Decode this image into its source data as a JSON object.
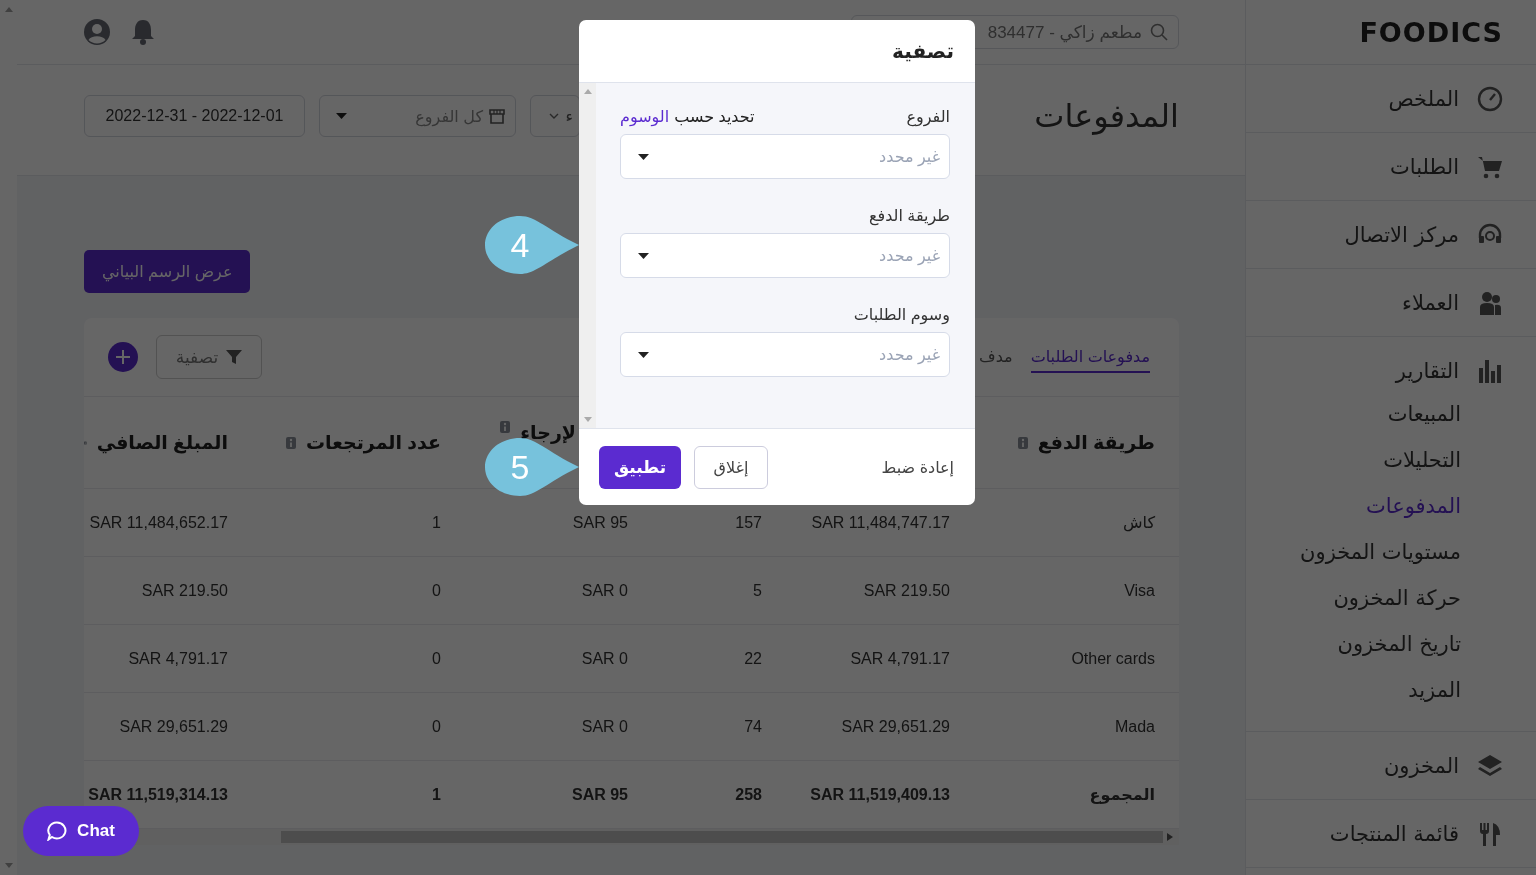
{
  "topbar": {
    "search_value": "مطعم زاكي - 834477"
  },
  "page": {
    "title": "المدفوعات",
    "filters": [
      {
        "kind": "dropdown",
        "text": "ء"
      },
      {
        "kind": "branches",
        "text": "كل الفروع"
      },
      {
        "kind": "date",
        "text": "2022-12-31 - 2022-12-01"
      }
    ],
    "chart_button": "عرض الرسم البياني"
  },
  "table": {
    "tabs": [
      {
        "label": "مدفوعات الطلبات",
        "selected": true
      },
      {
        "label": "مدف",
        "selected": false
      }
    ],
    "filter_button": "تصفية",
    "columns": [
      {
        "label": "طريقة الدفع"
      },
      {},
      {},
      {
        "label": "لإرجاء"
      },
      {
        "label": "عدد المرتجعات"
      },
      {
        "label": "المبلغ الصافي"
      }
    ],
    "rows": [
      {
        "cells": [
          "كاش",
          "SAR 11,484,747.17",
          "157",
          "SAR 95",
          "1",
          "SAR 11,484,652.17"
        ]
      },
      {
        "cells": [
          "Visa",
          "SAR 219.50",
          "5",
          "SAR 0",
          "0",
          "SAR 219.50"
        ]
      },
      {
        "cells": [
          "Other cards",
          "SAR 4,791.17",
          "22",
          "SAR 0",
          "0",
          "SAR 4,791.17"
        ]
      },
      {
        "cells": [
          "Mada",
          "SAR 29,651.29",
          "74",
          "SAR 0",
          "0",
          "SAR 29,651.29"
        ]
      }
    ],
    "total_row": [
      "المجموع",
      "SAR 11,519,409.13",
      "258",
      "SAR 95",
      "1",
      "SAR 11,519,314.13"
    ]
  },
  "sidebar": {
    "brand": "FOODICS",
    "items": [
      {
        "label": "الملخص"
      },
      {
        "label": "الطلبات"
      },
      {
        "label": "مركز الاتصال"
      },
      {
        "label": "العملاء"
      },
      {
        "label": "التقارير",
        "expanded": true,
        "children": [
          {
            "label": "المبيعات",
            "selected": false
          },
          {
            "label": "التحليلات",
            "selected": false
          },
          {
            "label": "المدفوعات",
            "selected": true
          },
          {
            "label": "مستويات المخزون",
            "selected": false
          },
          {
            "label": "حركة المخزون",
            "selected": false
          },
          {
            "label": "تاريخ المخزون",
            "selected": false
          },
          {
            "label": "المزيد",
            "selected": false
          }
        ]
      },
      {
        "label": "المخزون"
      },
      {
        "label": "قائمة المنتجات"
      }
    ]
  },
  "modal": {
    "title": "تصفية",
    "fields": [
      {
        "label": "الفروع",
        "aside_text": "تحديد حسب",
        "aside_link": "الوسوم",
        "placeholder": "غير محدد"
      },
      {
        "label": "طريقة الدفع",
        "placeholder": "غير محدد"
      },
      {
        "label": "وسوم الطلبات",
        "placeholder": "غير محدد"
      }
    ],
    "reset": "إعادة ضبط",
    "close": "إغلاق",
    "apply": "تطبيق"
  },
  "callouts": [
    {
      "text": "4"
    },
    {
      "text": "5"
    }
  ],
  "chat": "Chat"
}
